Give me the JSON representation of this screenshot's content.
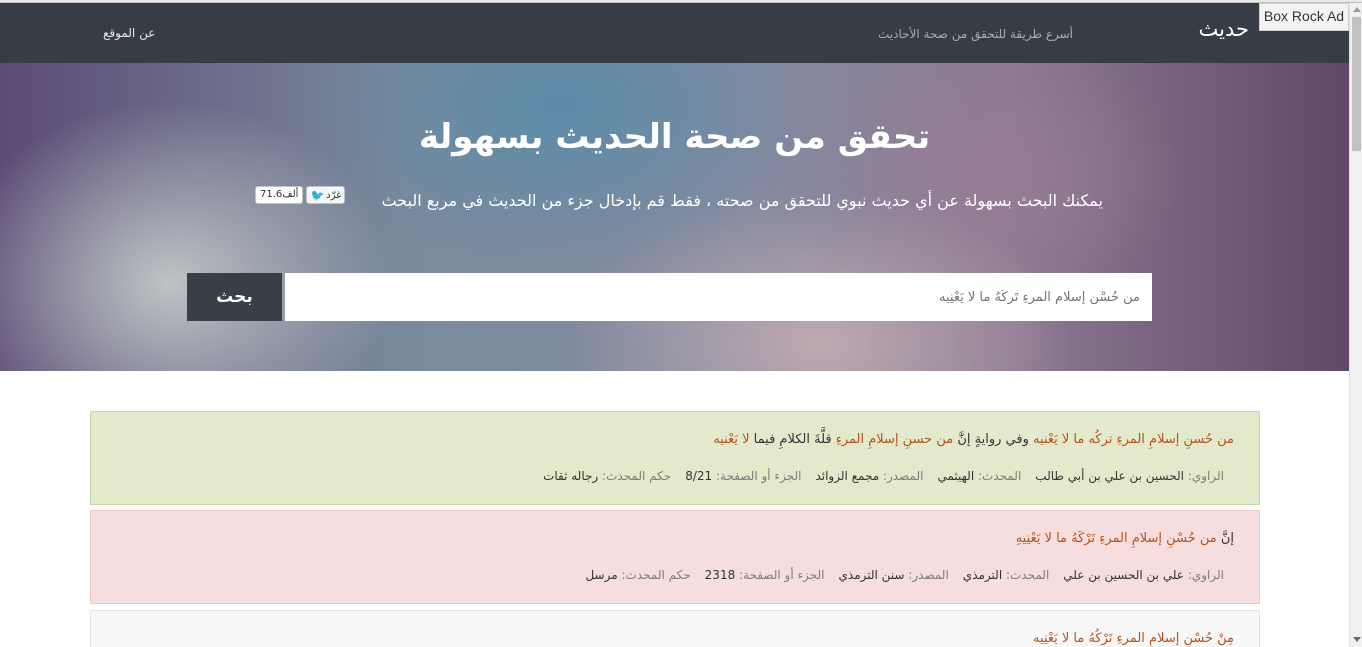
{
  "navbar": {
    "brand": "حديث",
    "tagline": "أسرع طريقة للتحقق من صحة الأحاديث",
    "about": "عن الموقع"
  },
  "ad": {
    "label": "Box Rock Ad"
  },
  "hero": {
    "title": "تحقق من صحة الحديث بسهولة",
    "subtitle": "يمكنك البحث بسهولة عن أي حديث نبوي للتحقق من صحته ، فقط قم بإدخال جزء من الحديث في مربع البحث",
    "tweet_label": "غرّد",
    "tweet_count": "71.6ألف"
  },
  "search": {
    "button": "بحث",
    "placeholder": "من حُسْنِ إسلامِ المرءِ تَركُهُ ما لا يَعْنِيه"
  },
  "results": [
    {
      "hadith_parts": [
        "من حُسنِ إسلامِ المرءِ تركُه ما لا يَعْنيه",
        " وفي روايةٍ إنَّ ",
        "من حسنِ إسلامِ المرءِ",
        " قلَّةَ الكلامِ فيما ",
        "لا يَعْنيه"
      ],
      "narrator_label": "الراوي:",
      "narrator": "الحسين بن علي بن أبي طالب",
      "scholar_label": "المحدث:",
      "scholar": "الهيثمي",
      "source_label": "المصدر:",
      "source": "مجمع الزوائد",
      "page_label": "الجزء أو الصفحة:",
      "page": "8/21",
      "ruling_label": "حكم المحدث:",
      "ruling": "رجاله ثقات"
    },
    {
      "hadith_parts": [
        "إنَّ ",
        "من حُسْنِ إسلامِ المرءِ تَرْكَهُ ما لا يَعْنِيهِ"
      ],
      "narrator_label": "الراوي:",
      "narrator": "علي بن الحسين بن علي",
      "scholar_label": "المحدث:",
      "scholar": "الترمذي",
      "source_label": "المصدر:",
      "source": "سنن الترمذي",
      "page_label": "الجزء أو الصفحة:",
      "page": "2318",
      "ruling_label": "حكم المحدث:",
      "ruling": "مرسل"
    },
    {
      "hadith_parts": [
        "مِنْ حُسْنِ إسلامِ المرءِ تَرْكُهُ ما لا يَعْنِيه"
      ]
    }
  ]
}
